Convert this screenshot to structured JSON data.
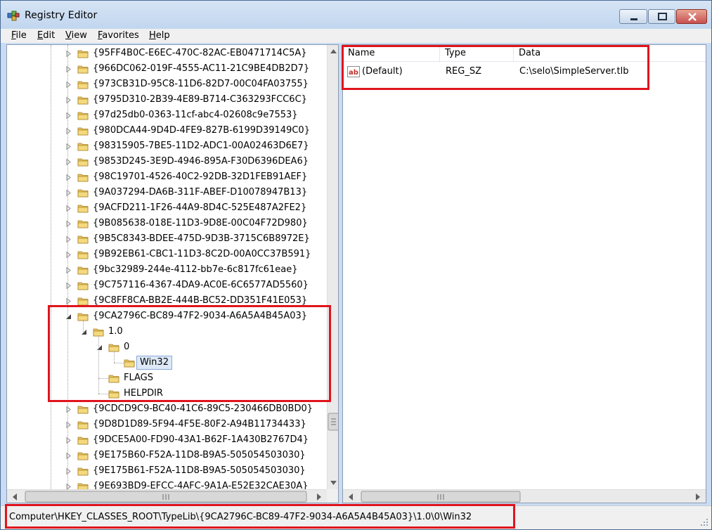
{
  "window": {
    "title": "Registry Editor",
    "colors": {
      "highlight": "#e0141d",
      "selection": "#dde9f7"
    }
  },
  "menu": [
    {
      "label": "File",
      "ul": "F",
      "rest": "ile"
    },
    {
      "label": "Edit",
      "ul": "E",
      "rest": "dit"
    },
    {
      "label": "View",
      "ul": "V",
      "rest": "iew"
    },
    {
      "label": "Favorites",
      "ul": "F",
      "rest": "avorites"
    },
    {
      "label": "Help",
      "ul": "H",
      "rest": "elp"
    }
  ],
  "tree": {
    "keys_before": [
      "{95FF4B0C-E6EC-470C-82AC-EB0471714C5A}",
      "{966DC062-019F-4555-AC11-21C9BE4DB2D7}",
      "{973CB31D-95C8-11D6-82D7-00C04FA03755}",
      "{9795D310-2B39-4E89-B714-C363293FCC6C}",
      "{97d25db0-0363-11cf-abc4-02608c9e7553}",
      "{980DCA44-9D4D-4FE9-827B-6199D39149C0}",
      "{98315905-7BE5-11D2-ADC1-00A02463D6E7}",
      "{9853D245-3E9D-4946-895A-F30D6396DEA6}",
      "{98C19701-4526-40C2-92DB-32D1FEB91AEF}",
      "{9A037294-DA6B-311F-ABEF-D10078947B13}",
      "{9ACFD211-1F26-44A9-8D4C-525E487A2FE2}",
      "{9B085638-018E-11D3-9D8E-00C04F72D980}",
      "{9B5C8343-BDEE-475D-9D3B-3715C6B8972E}",
      "{9B92EB61-CBC1-11D3-8C2D-00A0CC37B591}",
      "{9bc32989-244e-4112-bb7e-6c817fc61eae}",
      "{9C757116-4367-4DA9-AC0E-6C6577AD5560}",
      "{9C8FF8CA-BB2E-444B-BC52-DD351F41E053}"
    ],
    "expanded_key": "{9CA2796C-BC89-47F2-9034-A6A5A4B45A03}",
    "version_key": "1.0",
    "lcid_key": "0",
    "selected_key": "Win32",
    "flags_key": "FLAGS",
    "helpdir_key": "HELPDIR",
    "keys_after": [
      "{9CDCD9C9-BC40-41C6-89C5-230466DB0BD0}",
      "{9D8D1D89-5F94-4F5E-80F2-A94B11734433}",
      "{9DCE5A00-FD90-43A1-B62F-1A430B2767D4}",
      "{9E175B60-F52A-11D8-B9A5-505054503030}",
      "{9E175B61-F52A-11D8-B9A5-505054503030}",
      "{9E693BD9-EFCC-4AFC-9A1A-E52E32CAE30A}"
    ]
  },
  "values": {
    "columns": {
      "name": "Name",
      "type": "Type",
      "data": "Data"
    },
    "rows": [
      {
        "name": "(Default)",
        "type": "REG_SZ",
        "data": "C:\\selo\\SimpleServer.tlb",
        "icon": "ab-string-icon"
      }
    ]
  },
  "status": {
    "path": "Computer\\HKEY_CLASSES_ROOT\\TypeLib\\{9CA2796C-BC89-47F2-9034-A6A5A4B45A03}\\1.0\\0\\Win32"
  }
}
